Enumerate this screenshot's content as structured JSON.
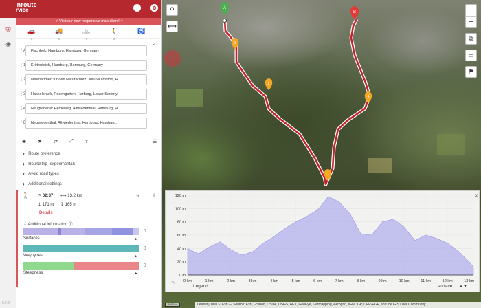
{
  "app": {
    "logo_line1": "openroute",
    "logo_line2": "service",
    "version": "0.7.2"
  },
  "header": {
    "banner": "> Visit our new responsive map client! <"
  },
  "profiles": [
    {
      "name": "car-icon",
      "glyph": "🚗"
    },
    {
      "name": "truck-icon",
      "glyph": "🚚"
    },
    {
      "name": "bike-icon",
      "glyph": "🚲"
    },
    {
      "name": "pedestrian-icon",
      "glyph": "🚶"
    },
    {
      "name": "wheelchair-icon",
      "glyph": "♿"
    }
  ],
  "waypoints": [
    {
      "label": "A",
      "value": "Fischbek, Hamburg, Hamburg, Germany"
    },
    {
      "label": "1",
      "value": "Krötenteich, Hamburg, Hamburg, Germany"
    },
    {
      "label": "2",
      "value": "Maßnahmen für den Naturschutz, Neu Wulmstorf, H"
    },
    {
      "label": "3",
      "value": "Hasselbrack, Rosengarten, Harburg, Lower Saxony,"
    },
    {
      "label": "4",
      "value": "Neugrabener Heideweg, Altwiedenthal, Hamburg, H"
    },
    {
      "label": "B",
      "value": "Neuwiedenthal, Altwiedenthal, Hamburg, Hamburg,"
    }
  ],
  "options": [
    {
      "label": "Route preference"
    },
    {
      "label": "Round trip (experimental)"
    },
    {
      "label": "Avoid road types"
    },
    {
      "label": "Additional settings"
    }
  ],
  "summary": {
    "duration": "02:37",
    "distance": "13.2 km",
    "ascent": "171 m",
    "descent": "165 m",
    "details": "Details",
    "additional_info": "Additional information"
  },
  "info_bars": [
    {
      "label": "Surfaces",
      "segments": [
        {
          "color": "#b9b2e6",
          "frac": 0.3
        },
        {
          "color": "#8d83cf",
          "frac": 0.03
        },
        {
          "color": "#b9b2e6",
          "frac": 0.2
        },
        {
          "color": "#a5a4e4",
          "frac": 0.24
        },
        {
          "color": "#8f92de",
          "frac": 0.18
        },
        {
          "color": "#c9c6ee",
          "frac": 0.05
        }
      ]
    },
    {
      "label": "Way types",
      "segments": [
        {
          "color": "#5eb8b8",
          "frac": 1.0
        }
      ]
    },
    {
      "label": "Steepness",
      "segments": [
        {
          "color": "#8ed98e",
          "frac": 0.44
        },
        {
          "color": "#e8868a",
          "frac": 0.56
        }
      ]
    }
  ],
  "map": {
    "attribution": "Leaflet | Tiles © Esri — Source: Esri, i-cubed, USDA, USGS, AEX, GeoEye, Getmapping, Aerogrid, IGN, IGP, UPR-EGP, and the GIS User Community",
    "scale": "1000 m",
    "markers": [
      {
        "label": "A",
        "color": "#4caf50"
      },
      {
        "label": "B",
        "color": "#e53935"
      },
      {
        "label": "1",
        "color": "#f5a623"
      },
      {
        "label": "2",
        "color": "#f5a623"
      },
      {
        "label": "3",
        "color": "#f5a623"
      },
      {
        "label": "4",
        "color": "#f5a623"
      }
    ]
  },
  "chart_data": {
    "type": "area",
    "title": "",
    "xlabel": "",
    "ylabel": "",
    "x": [
      0,
      0.5,
      1,
      1.5,
      2,
      2.5,
      3,
      3.5,
      4,
      4.5,
      5,
      5.5,
      6,
      6.5,
      7,
      7.5,
      8,
      8.5,
      9,
      9.5,
      10,
      10.5,
      11,
      11.5,
      12,
      12.5,
      13,
      13.2
    ],
    "series": [
      {
        "values": [
          40,
          32,
          42,
          50,
          38,
          30,
          35,
          48,
          58,
          70,
          80,
          88,
          98,
          118,
          110,
          92,
          62,
          60,
          80,
          84,
          72,
          52,
          60,
          55,
          48,
          36,
          20,
          12
        ]
      }
    ],
    "xlim": [
      0,
      13.2
    ],
    "ylim": [
      0,
      120
    ],
    "x_tick_labels": [
      "0 km",
      "1 km",
      "2 km",
      "3 km",
      "4 km",
      "5 km",
      "6 km",
      "7 km",
      "8 km",
      "9 km",
      "10 km",
      "11 km",
      "12 km",
      "13 km"
    ],
    "y_tick_labels": [
      "0 m",
      "20 m",
      "40 m",
      "60 m",
      "80 m",
      "100 m",
      "120 m"
    ],
    "legend": {
      "label": "Legend",
      "selector": "surface"
    }
  }
}
